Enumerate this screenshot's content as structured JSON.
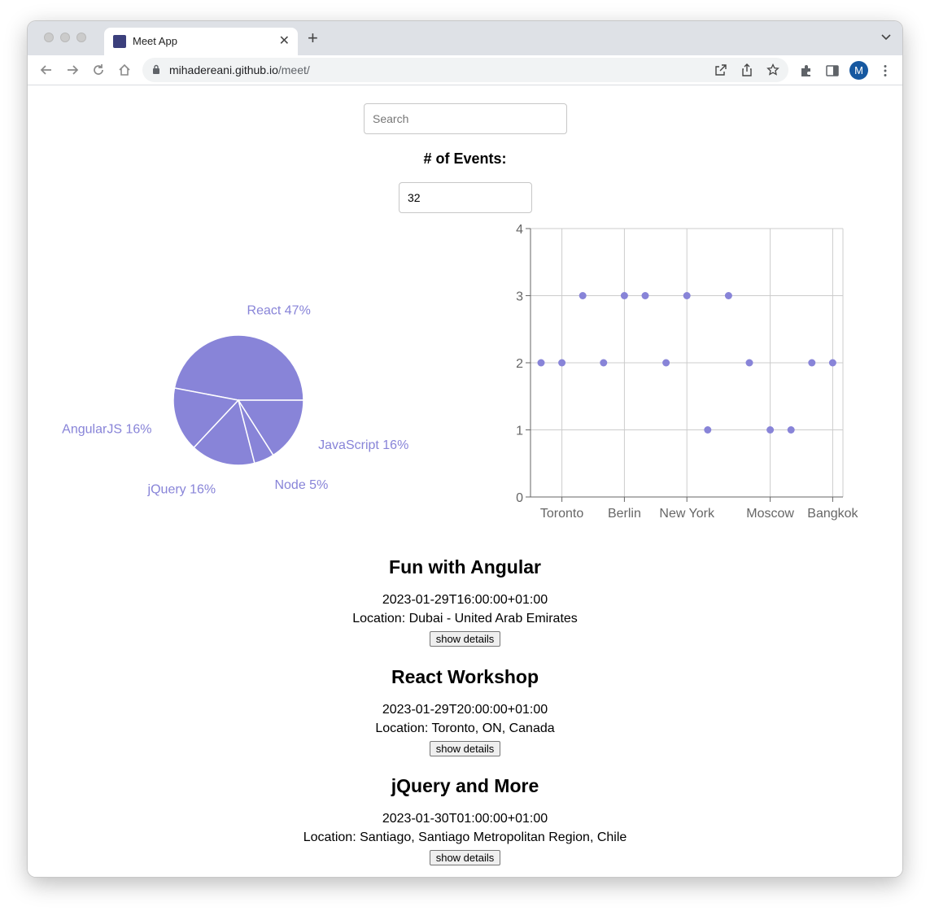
{
  "browser": {
    "tab_title": "Meet App",
    "url_host": "mihadereani.github.io",
    "url_path": "/meet/",
    "profile_initial": "M"
  },
  "search": {
    "placeholder": "Search"
  },
  "number_of_events": {
    "label": "# of Events:",
    "value": "32"
  },
  "colors": {
    "accent": "#8884d8"
  },
  "chart_data": [
    {
      "type": "pie",
      "slices": [
        {
          "label": "React",
          "percent": 47
        },
        {
          "label": "AngularJS",
          "percent": 16
        },
        {
          "label": "jQuery",
          "percent": 16
        },
        {
          "label": "Node",
          "percent": 5
        },
        {
          "label": "JavaScript",
          "percent": 16
        }
      ]
    },
    {
      "type": "scatter",
      "x_tick_labels": [
        "Toronto",
        "Berlin",
        "New York",
        "Moscow",
        "Bangkok"
      ],
      "y_ticks": [
        0,
        1,
        2,
        3,
        4
      ],
      "ylim": [
        0,
        4
      ],
      "grid": true,
      "y_values": [
        2,
        2,
        3,
        2,
        3,
        3,
        2,
        3,
        1,
        3,
        2,
        1,
        1,
        2,
        2
      ]
    }
  ],
  "events": [
    {
      "summary": "Fun with Angular",
      "start": "2023-01-29T16:00:00+01:00",
      "location": "Location: Dubai - United Arab Emirates",
      "button": "show details"
    },
    {
      "summary": "React Workshop",
      "start": "2023-01-29T20:00:00+01:00",
      "location": "Location: Toronto, ON, Canada",
      "button": "show details"
    },
    {
      "summary": "jQuery and More",
      "start": "2023-01-30T01:00:00+01:00",
      "location": "Location: Santiago, Santiago Metropolitan Region, Chile",
      "button": "show details"
    }
  ]
}
